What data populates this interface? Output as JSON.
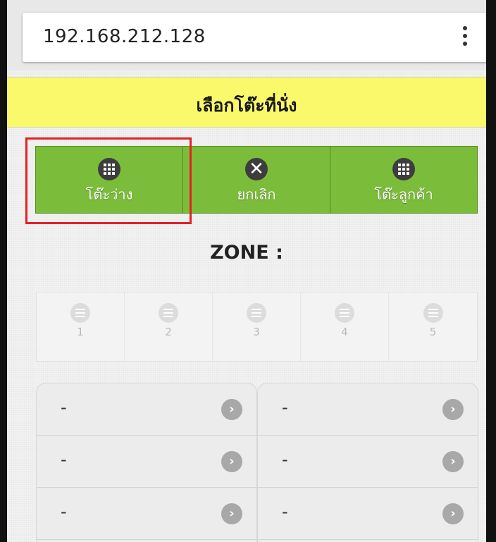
{
  "browser": {
    "url": "192.168.212.128"
  },
  "page": {
    "title": "เลือกโต๊ะที่นั่ง"
  },
  "actions": [
    {
      "label": "โต๊ะว่าง",
      "icon": "grid-icon"
    },
    {
      "label": "ยกเลิก",
      "icon": "close-icon"
    },
    {
      "label": "โต๊ะลูกค้า",
      "icon": "grid-icon"
    }
  ],
  "zone": {
    "label": "ZONE :",
    "items": [
      "1",
      "2",
      "3",
      "4",
      "5"
    ]
  },
  "tables": {
    "left": [
      "-",
      "-",
      "-"
    ],
    "right": [
      "-",
      "-",
      "-"
    ]
  },
  "colors": {
    "accent_green": "#7cbc3b",
    "title_yellow": "#faf86b",
    "highlight_red": "#e32025"
  }
}
